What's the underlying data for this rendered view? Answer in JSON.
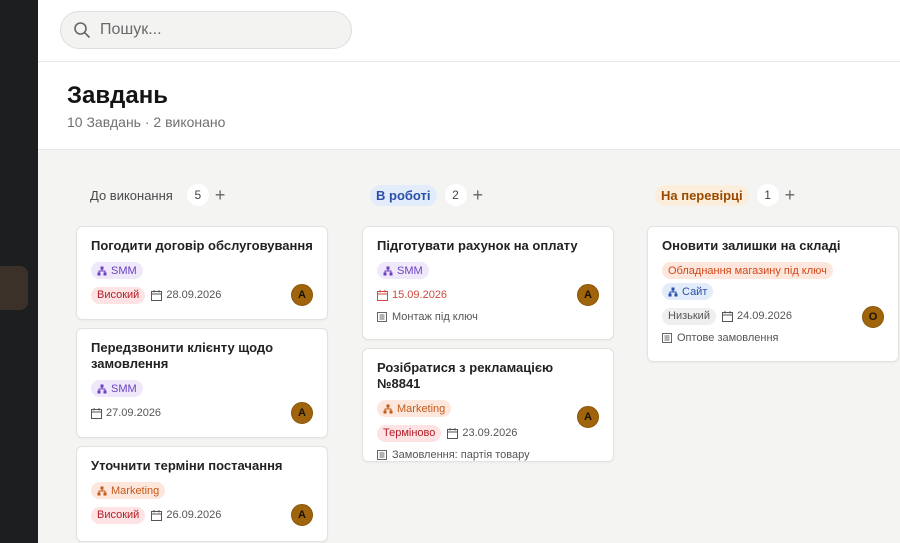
{
  "search": {
    "placeholder": "Пошук..."
  },
  "page": {
    "title": "Завдань",
    "subtitle": "10 Завдань · 2 виконано"
  },
  "columns": [
    {
      "title": "До виконання",
      "count": "5",
      "add": "+",
      "cards": [
        {
          "title": "Погодити договір обслуговування",
          "tags": [
            "SMM"
          ],
          "priority": "Високий",
          "date": "28.09.2026",
          "assignee": "А"
        },
        {
          "title": "Передзвонити клієнту щодо замовлення",
          "tags": [
            "SMM"
          ],
          "priority": "",
          "date": "27.09.2026",
          "assignee": "А"
        },
        {
          "title": "Уточнити терміни постачання",
          "tags": [
            "Marketing"
          ],
          "priority": "Високий",
          "date": "26.09.2026",
          "assignee": "А"
        }
      ]
    },
    {
      "title": "В роботі",
      "count": "2",
      "add": "+",
      "cards": [
        {
          "title": "Підготувати рахунок на оплату",
          "tags": [
            "SMM"
          ],
          "priority": "",
          "date": "15.09.2026",
          "date_overdue": true,
          "assignee": "А",
          "project": "Монтаж під ключ"
        },
        {
          "title": "Розібратися з рекламацією №8841",
          "tags": [
            "Marketing"
          ],
          "priority": "Терміново",
          "date": "23.09.2026",
          "assignee": "А",
          "project": "Замовлення: партія товару"
        }
      ]
    },
    {
      "title": "На перевірці",
      "count": "1",
      "add": "+",
      "cards": [
        {
          "title": "Оновити залишки на складі",
          "tags": [
            "Обладнання магазину під ключ",
            "Сайт"
          ],
          "priority": "Низький",
          "date": "24.09.2026",
          "assignee": "О",
          "project": "Оптове замовлення"
        }
      ]
    }
  ],
  "colors": {
    "accent_blue": "#2a4fa8",
    "accent_orange": "#9a4a00",
    "avatar": "#a0640c",
    "overdue": "#d04a3f"
  },
  "icons": {
    "search": "search-icon",
    "tag": "hierarchy-icon",
    "date": "calendar-icon",
    "project": "document-icon"
  }
}
